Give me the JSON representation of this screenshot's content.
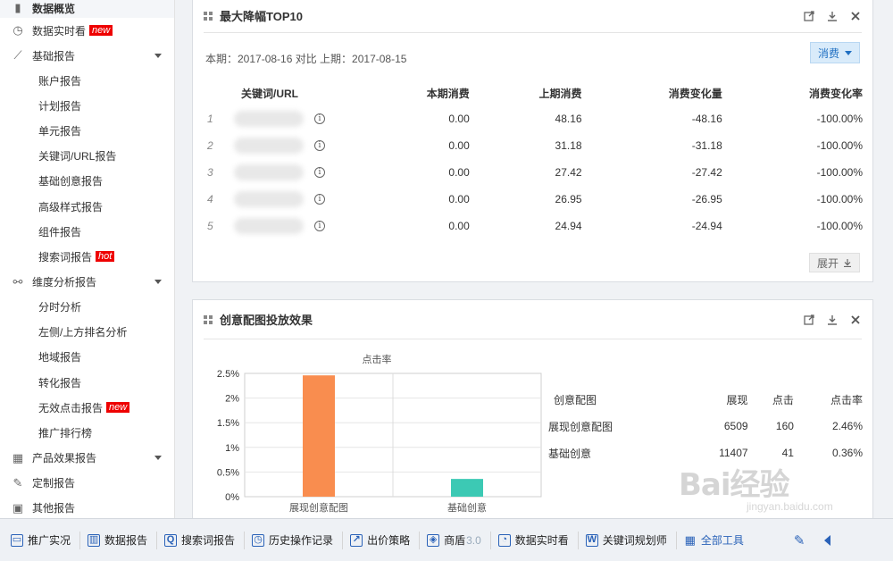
{
  "sidebar": {
    "items": [
      {
        "label": "数据概览",
        "icon": "bar-chart-icon",
        "type": "top",
        "first": true
      },
      {
        "label": "数据实时看",
        "icon": "stopwatch-icon",
        "type": "top",
        "badge": "new"
      },
      {
        "label": "基础报告",
        "icon": "line-chart-icon",
        "type": "top",
        "caret": true
      },
      {
        "label": "账户报告",
        "type": "sub"
      },
      {
        "label": "计划报告",
        "type": "sub"
      },
      {
        "label": "单元报告",
        "type": "sub"
      },
      {
        "label": "关键词/URL报告",
        "type": "sub"
      },
      {
        "label": "基础创意报告",
        "type": "sub"
      },
      {
        "label": "高级样式报告",
        "type": "sub"
      },
      {
        "label": "组件报告",
        "type": "sub"
      },
      {
        "label": "搜索词报告",
        "type": "sub",
        "badge": "hot"
      },
      {
        "label": "维度分析报告",
        "icon": "network-icon",
        "type": "top",
        "caret": true
      },
      {
        "label": "分时分析",
        "type": "sub"
      },
      {
        "label": "左侧/上方排名分析",
        "type": "sub"
      },
      {
        "label": "地域报告",
        "type": "sub"
      },
      {
        "label": "转化报告",
        "type": "sub"
      },
      {
        "label": "无效点击报告",
        "type": "sub",
        "badge": "new"
      },
      {
        "label": "推广排行榜",
        "type": "sub"
      },
      {
        "label": "产品效果报告",
        "icon": "calculator-icon",
        "type": "top",
        "caret": true
      },
      {
        "label": "定制报告",
        "icon": "edit-box-icon",
        "type": "top"
      },
      {
        "label": "其他报告",
        "icon": "doc-icon",
        "type": "top"
      }
    ]
  },
  "top10": {
    "title": "最大降幅TOP10",
    "period": "本期：2017-08-16 对比 上期：2017-08-15",
    "metric_button": "消费",
    "columns": [
      "关键词/URL",
      "本期消费",
      "上期消费",
      "消费变化量",
      "消费变化率"
    ],
    "rows": [
      {
        "idx": "1",
        "cur": "0.00",
        "prev": "48.16",
        "delta": "-48.16",
        "rate": "-100.00%"
      },
      {
        "idx": "2",
        "cur": "0.00",
        "prev": "31.18",
        "delta": "-31.18",
        "rate": "-100.00%"
      },
      {
        "idx": "3",
        "cur": "0.00",
        "prev": "27.42",
        "delta": "-27.42",
        "rate": "-100.00%"
      },
      {
        "idx": "4",
        "cur": "0.00",
        "prev": "26.95",
        "delta": "-26.95",
        "rate": "-100.00%"
      },
      {
        "idx": "5",
        "cur": "0.00",
        "prev": "24.94",
        "delta": "-24.94",
        "rate": "-100.00%"
      }
    ],
    "expand_label": "展开"
  },
  "creative": {
    "title": "创意配图投放效果",
    "columns": [
      "创意配图",
      "展现",
      "点击",
      "点击率"
    ],
    "rows": [
      {
        "name": "展现创意配图",
        "impr": "6509",
        "clicks": "160",
        "ctr": "2.46%"
      },
      {
        "name": "基础创意",
        "impr": "11407",
        "clicks": "41",
        "ctr": "0.36%"
      }
    ]
  },
  "chart_data": {
    "type": "bar",
    "title": "点击率",
    "categories": [
      "展现创意配图",
      "基础创意"
    ],
    "values": [
      2.46,
      0.36
    ],
    "colors": [
      "#f98d4f",
      "#3cc9b4"
    ],
    "yticks": [
      "0%",
      "0.5%",
      "1%",
      "1.5%",
      "2%",
      "2.5%"
    ],
    "ylim": [
      0,
      2.5
    ],
    "xlabel": "",
    "ylabel": "",
    "grid": true
  },
  "toolbar": {
    "items": [
      {
        "label": "推广实况",
        "icon": "monitor-icon"
      },
      {
        "label": "数据报告",
        "icon": "report-chart-icon"
      },
      {
        "label": "搜索词报告",
        "icon": "search-report-icon"
      },
      {
        "label": "历史操作记录",
        "icon": "history-clock-icon"
      },
      {
        "label": "出价策略",
        "icon": "bid-strategy-icon"
      },
      {
        "label": "商盾",
        "suffix": "3.0",
        "icon": "shield-icon"
      },
      {
        "label": "数据实时看",
        "icon": "realtime-clock-icon"
      },
      {
        "label": "关键词规划师",
        "icon": "word-doc-icon"
      },
      {
        "label": "全部工具",
        "icon": "grid-icon",
        "blue": true
      }
    ]
  },
  "watermark": {
    "main": "Bai经验",
    "sub": "jingyan.baidu.com"
  }
}
